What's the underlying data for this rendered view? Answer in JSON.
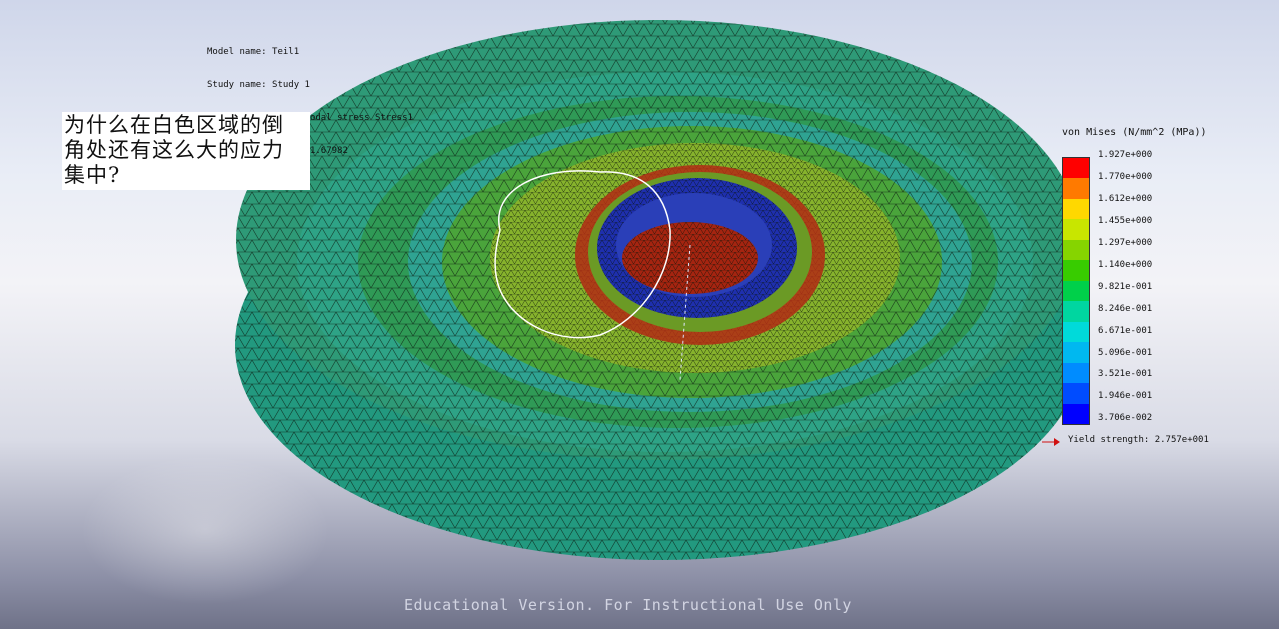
{
  "viewport": {
    "model_name_line": "Model name: Teil1",
    "study_name_line": "Study name: Study 1",
    "plot_type_line": "Plot type: Static nodal stress Stress1",
    "deformation_line": "Deformation scale: 1.67982"
  },
  "annotation": {
    "line1": "为什么在白色区域的倒",
    "line2": "角处还有这么大的应力",
    "line3": "集中?"
  },
  "legend": {
    "title": "von Mises (N/mm^2 (MPa))",
    "labels": [
      "1.927e+000",
      "1.770e+000",
      "1.612e+000",
      "1.455e+000",
      "1.297e+000",
      "1.140e+000",
      "9.821e-001",
      "8.246e-001",
      "6.671e-001",
      "5.096e-001",
      "3.521e-001",
      "1.946e-001",
      "3.706e-002"
    ],
    "colors": [
      "#ff0000",
      "#ff7a00",
      "#ffd800",
      "#c8e600",
      "#86d400",
      "#38cc00",
      "#00d04a",
      "#00d6a0",
      "#00dada",
      "#00b8f0",
      "#008cff",
      "#004cff",
      "#0000ff"
    ],
    "yield_strength": "Yield strength: 2.757e+001"
  },
  "footer": {
    "watermark": "Educational Version. For Instructional Use Only"
  },
  "colors": {
    "mesh_teal": "#2aa07a",
    "mesh_green": "#4fb43a",
    "inner_yellowgreen": "#7fb82a",
    "stress_red": "#c01010",
    "stress_blue": "#1a2fb0",
    "annotation_outline": "#ffffff"
  }
}
